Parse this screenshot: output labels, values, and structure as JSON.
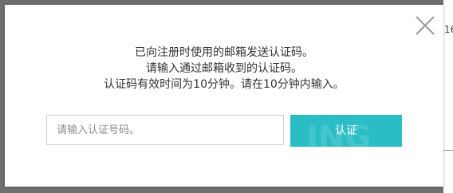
{
  "dialog": {
    "message_lines": [
      "已向注册时使用的邮箱发送认证码。",
      "请输入通过邮箱收到的认证码。",
      "认证码有效时间为10分钟。请在10分钟内输入。"
    ],
    "input_placeholder": "请输入认证号码。",
    "input_value": "",
    "verify_label": "认证",
    "close_icon": "close-icon"
  },
  "background": {
    "partial_text": "16"
  },
  "colors": {
    "accent": "#2bbdc6",
    "overlay": "#6f6f6f",
    "text": "#333333"
  }
}
